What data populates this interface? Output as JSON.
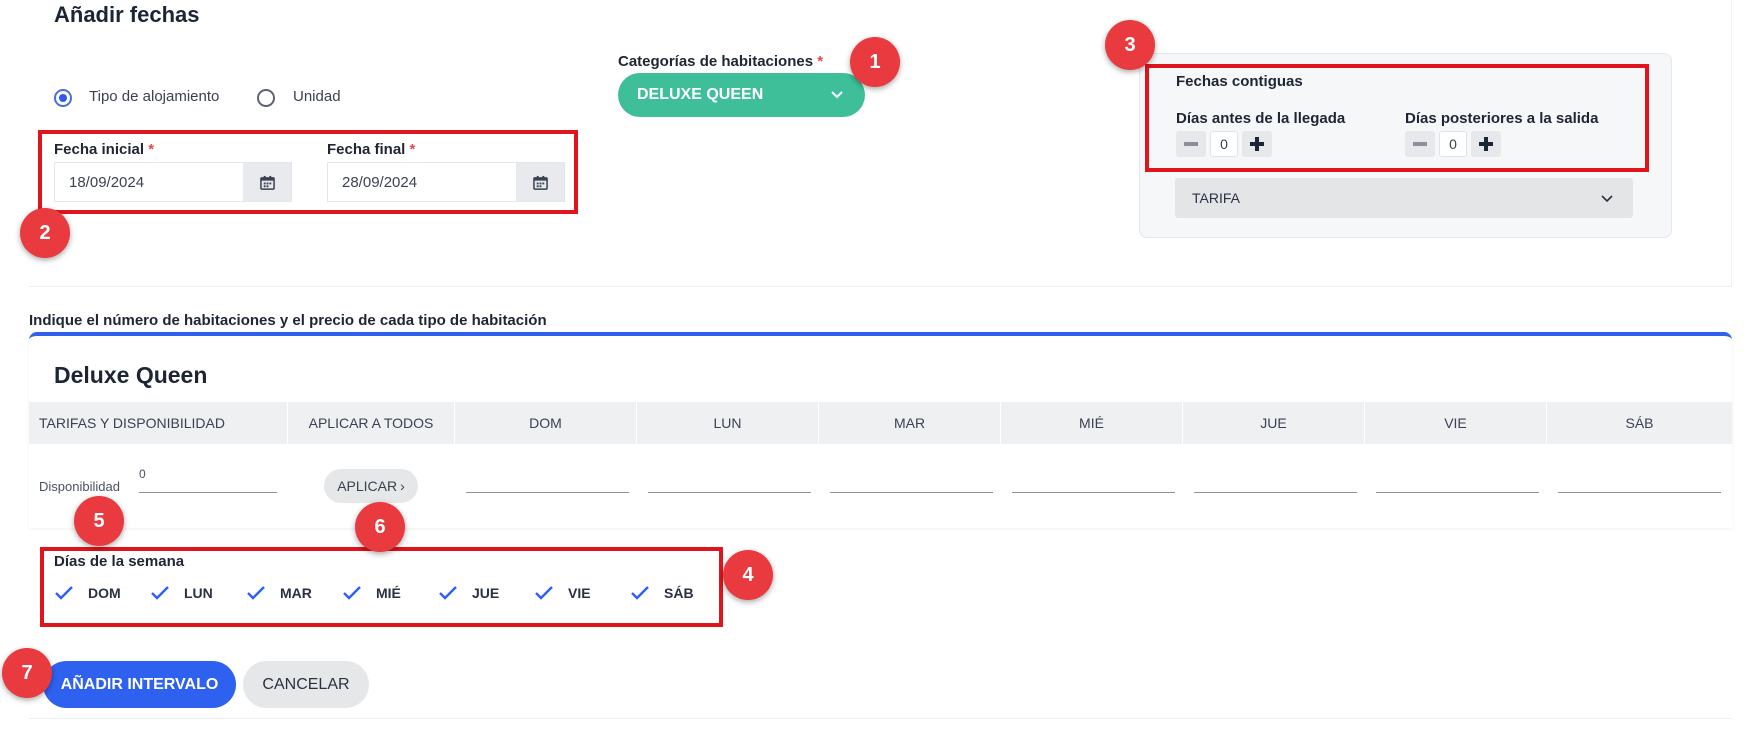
{
  "page_title": "Añadir fechas",
  "accommodation": {
    "options": [
      {
        "label": "Tipo de alojamiento",
        "selected": true
      },
      {
        "label": "Unidad",
        "selected": false
      }
    ]
  },
  "dates": {
    "start_label": "Fecha inicial",
    "start_value": "18/09/2024",
    "end_label": "Fecha final",
    "end_value": "28/09/2024",
    "required_mark": "*"
  },
  "categories": {
    "label": "Categorías de habitaciones",
    "required_mark": "*",
    "selected": "DELUXE QUEEN",
    "color": "#3ebf9a"
  },
  "contiguous": {
    "title": "Fechas contiguas",
    "before_label": "Días antes de la llegada",
    "before_value": "0",
    "after_label": "Días posteriores a la salida",
    "after_value": "0",
    "rate_select": "TARIFA"
  },
  "rooms_section": {
    "instruction": "Indique el número de habitaciones y el precio de cada tipo de habitación",
    "room_title": "Deluxe Queen",
    "columns": [
      "TARIFAS Y DISPONIBILIDAD",
      "APLICAR A TODOS",
      "DOM",
      "LUN",
      "MAR",
      "MIÉ",
      "JUE",
      "VIE",
      "SÁB"
    ],
    "availability_label": "Disponibilidad",
    "availability_value": "0",
    "apply_button": "APLICAR",
    "apply_arrow": "›"
  },
  "weekdays": {
    "title": "Días de la semana",
    "days": [
      "DOM",
      "LUN",
      "MAR",
      "MIÉ",
      "JUE",
      "VIE",
      "SÁB"
    ],
    "all_checked": true
  },
  "actions": {
    "add_interval": "AÑADIR INTERVALO",
    "cancel": "CANCELAR"
  },
  "annotations": [
    "1",
    "2",
    "3",
    "4",
    "5",
    "6",
    "7"
  ],
  "colors": {
    "accent_blue": "#2f61f0",
    "annotation_red": "#e0141c",
    "badge_red": "#e93a3f"
  }
}
